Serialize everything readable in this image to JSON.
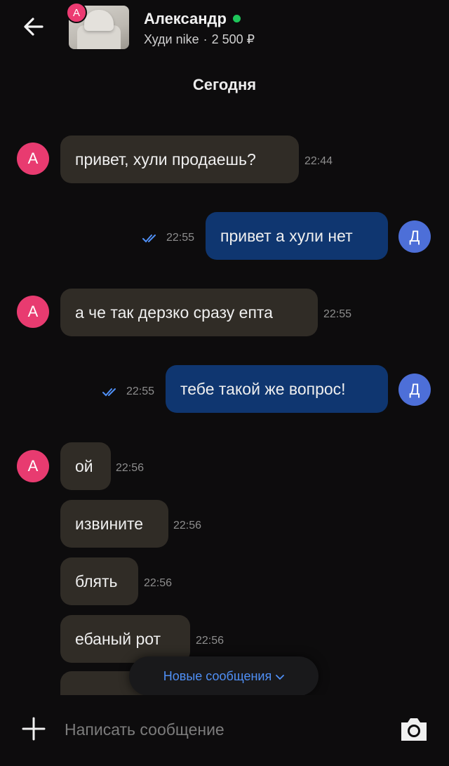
{
  "header": {
    "contact_name": "Александр",
    "online": true,
    "listing_title": "Худи nike",
    "separator": "·",
    "price": "2 500 ₽",
    "thumb_badge": "А"
  },
  "chat": {
    "day_label": "Сегодня",
    "messages": [
      {
        "direction": "in",
        "avatar": "А",
        "text": "привет, хули продаешь?",
        "time": "22:44"
      },
      {
        "direction": "out",
        "avatar": "Д",
        "text": "привет а хули нет",
        "time": "22:55",
        "read": true
      },
      {
        "direction": "in",
        "avatar": "А",
        "text": "а че так дерзко сразу епта",
        "time": "22:55"
      },
      {
        "direction": "out",
        "avatar": "Д",
        "text": "тебе такой же вопрос!",
        "time": "22:55",
        "read": true
      },
      {
        "direction": "in",
        "avatar": "А",
        "text": "ой",
        "time": "22:56"
      },
      {
        "direction": "in",
        "text": "извините",
        "time": "22:56"
      },
      {
        "direction": "in",
        "text": "блять",
        "time": "22:56"
      },
      {
        "direction": "in",
        "text": "ебаный рот",
        "time": "22:56"
      }
    ]
  },
  "new_messages_button": {
    "label": "Новые сообщения",
    "icon": "chevron-down-icon"
  },
  "composer": {
    "placeholder": "Написать сообщение",
    "add_icon": "plus-icon",
    "camera_icon": "camera-icon"
  },
  "colors": {
    "background": "#0d0c0d",
    "incoming_bubble": "#302c26",
    "outgoing_bubble": "#0f3670",
    "avatar_a": "#e83b70",
    "avatar_d": "#4d6fd8",
    "online": "#1ec65a",
    "link_blue": "#4f8ff5"
  }
}
